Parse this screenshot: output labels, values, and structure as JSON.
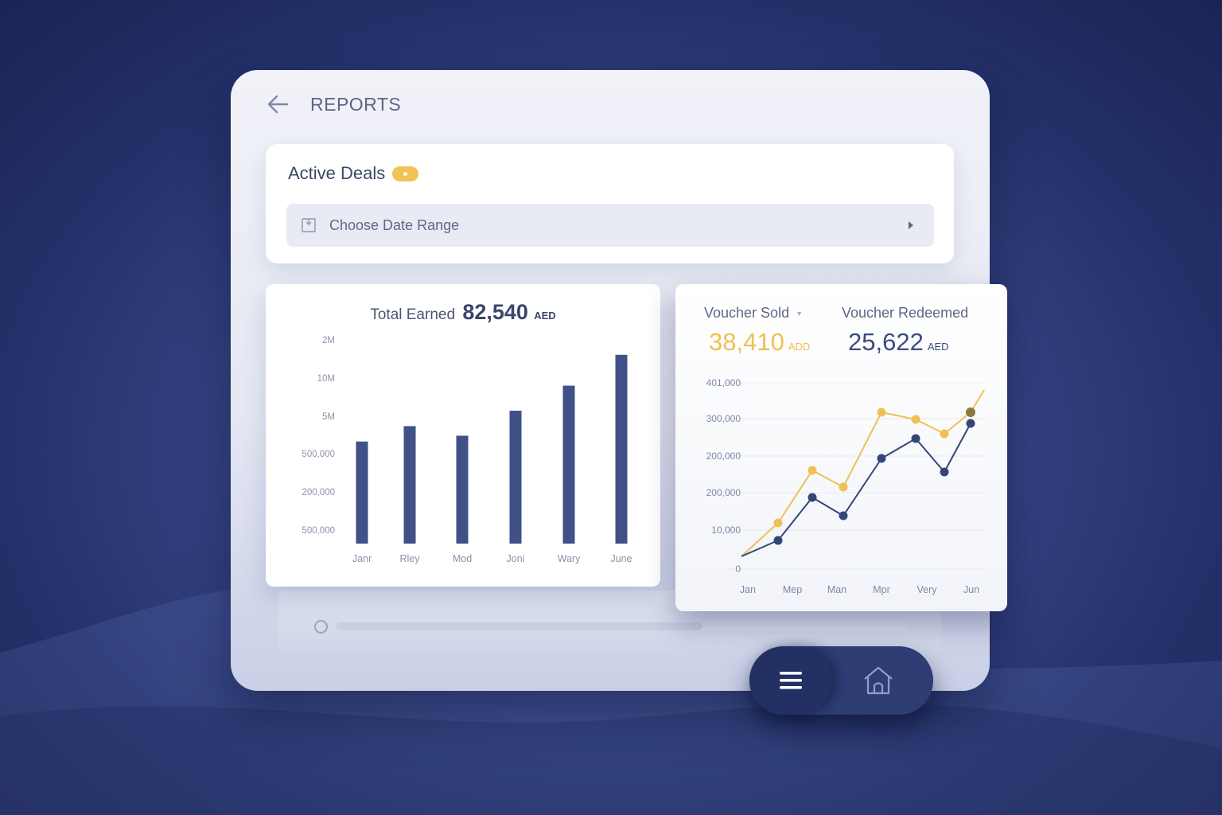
{
  "header": {
    "title": "REPORTS",
    "back_icon": "arrow-left-icon"
  },
  "active_deals": {
    "title": "Active Deals",
    "date_range_label": "Choose Date Range",
    "calendar_icon": "calendar-icon",
    "chevron_icon": "chevron-right-icon"
  },
  "total_earned": {
    "label": "Total Earned",
    "value": "82,540",
    "currency": "AED"
  },
  "vouchers": {
    "sold": {
      "label": "Voucher Sold",
      "value": "38,410",
      "currency": "ADD"
    },
    "redeemed": {
      "label": "Voucher Redeemed",
      "value": "25,622",
      "currency": "AED"
    }
  },
  "chart_data": [
    {
      "type": "bar",
      "title": "Total Earned 82,540 AED",
      "categories": [
        "Janr",
        "Rley",
        "Mod",
        "Joni",
        "Wary",
        "June"
      ],
      "y_tick_labels": [
        "2M",
        "10M",
        "5M",
        "500,000",
        "200,000",
        "500,000"
      ],
      "values_fraction_of_axis": [
        0.53,
        0.61,
        0.56,
        0.69,
        0.82,
        0.98
      ],
      "ylabel": "",
      "xlabel": "",
      "grid": false,
      "color": "#3f5186"
    },
    {
      "type": "line",
      "categories": [
        "Jan",
        "Mep",
        "Man",
        "Mpr",
        "Very",
        "Jun"
      ],
      "y_tick_labels": [
        "0",
        "10,000",
        "200,000",
        "200,000",
        "300,000",
        "401,000"
      ],
      "y_tick_positions": [
        0,
        1,
        2,
        3,
        4,
        5
      ],
      "x": [
        0,
        0.5,
        1,
        1.5,
        2,
        2.5,
        3,
        3.5,
        4,
        4.5,
        5
      ],
      "series": [
        {
          "color": "#f0c055",
          "values": [
            0.35,
            1.25,
            2.65,
            2.2,
            4.2,
            4.0,
            3.55,
            4.1,
            4.65
          ],
          "x": [
            0.0,
            0.75,
            1.45,
            2.1,
            2.75,
            3.5,
            4.15,
            4.8,
            5.3
          ]
        },
        {
          "color": "#334777",
          "values": [
            0.35,
            0.75,
            1.9,
            1.4,
            2.95,
            3.5,
            2.6,
            3.85
          ],
          "x": [
            0.0,
            0.8,
            1.45,
            2.2,
            2.8,
            3.55,
            4.2,
            4.8
          ]
        }
      ],
      "grid": true,
      "legend": "none"
    }
  ],
  "menu_icon": "hamburger-menu-icon",
  "home_icon": "home-icon",
  "colors": {
    "accent_gold": "#f0bf4f",
    "navy": "#3b4b80",
    "background": "#2a3670"
  }
}
